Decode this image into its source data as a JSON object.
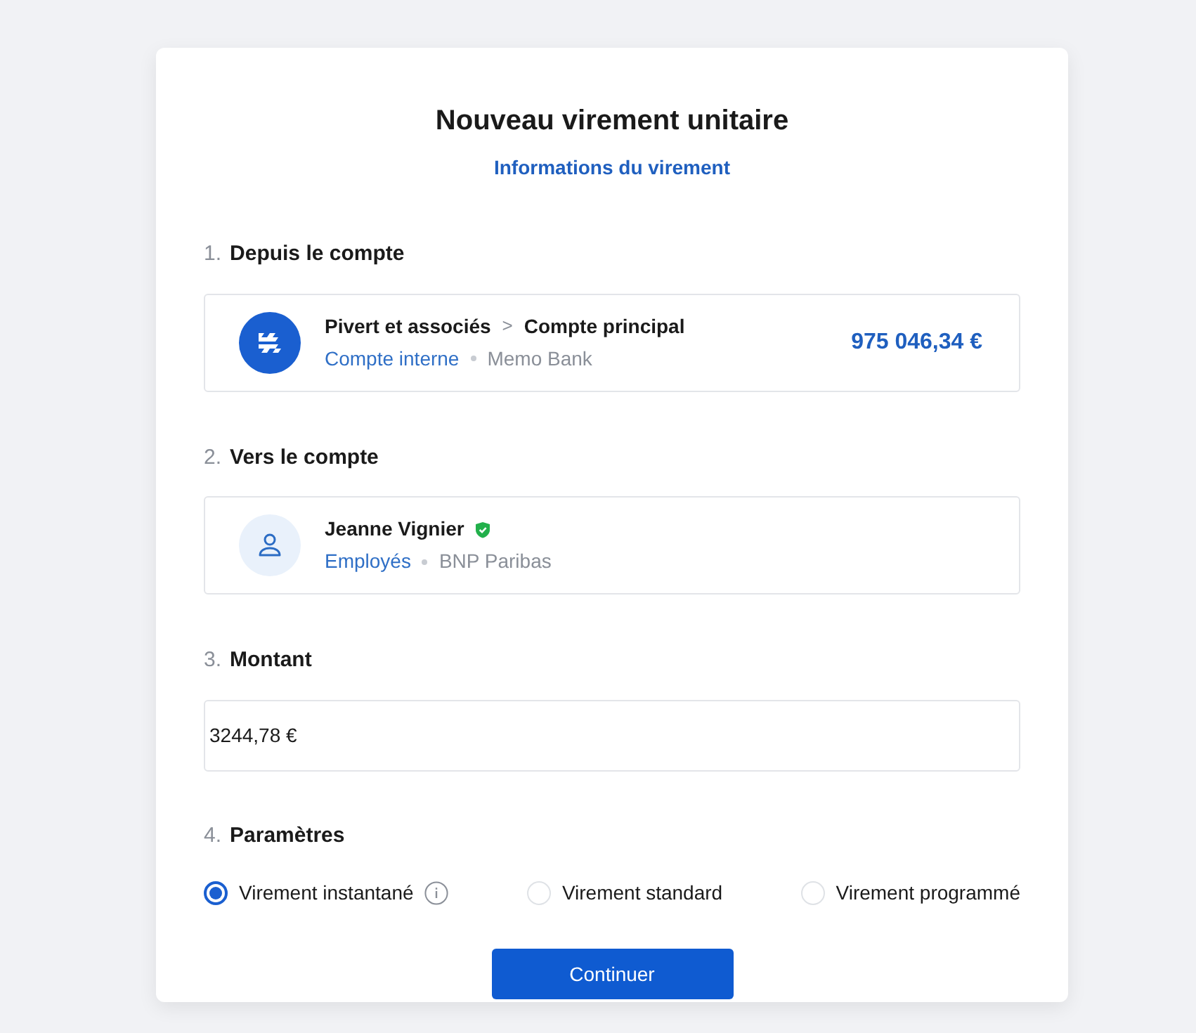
{
  "title": "Nouveau virement unitaire",
  "subtitle": "Informations du virement",
  "sections": [
    {
      "number": "1.",
      "label": "Depuis le compte",
      "kind": "account",
      "account": {
        "kind": "business",
        "name": "Pivert et associés",
        "separator": ">",
        "subaccount": "Compte principal",
        "verified": false,
        "category": "Compte interne",
        "bank": "Memo Bank",
        "balance": "975 046,34 €"
      }
    },
    {
      "number": "2.",
      "label": "Vers le compte",
      "kind": "account",
      "account": {
        "kind": "person",
        "name": "Jeanne Vignier",
        "verified": true,
        "category": "Employés",
        "bank": "BNP Paribas"
      }
    },
    {
      "number": "3.",
      "label": "Montant",
      "kind": "amount",
      "value": "3244,78 €"
    },
    {
      "number": "4.",
      "label": "Paramètres",
      "kind": "options",
      "options": [
        {
          "label": "Virement instantané",
          "selected": true,
          "info": true
        },
        {
          "label": "Virement standard",
          "selected": false,
          "info": false
        },
        {
          "label": "Virement programmé",
          "selected": false,
          "info": false
        }
      ]
    }
  ],
  "button": "Continuer"
}
